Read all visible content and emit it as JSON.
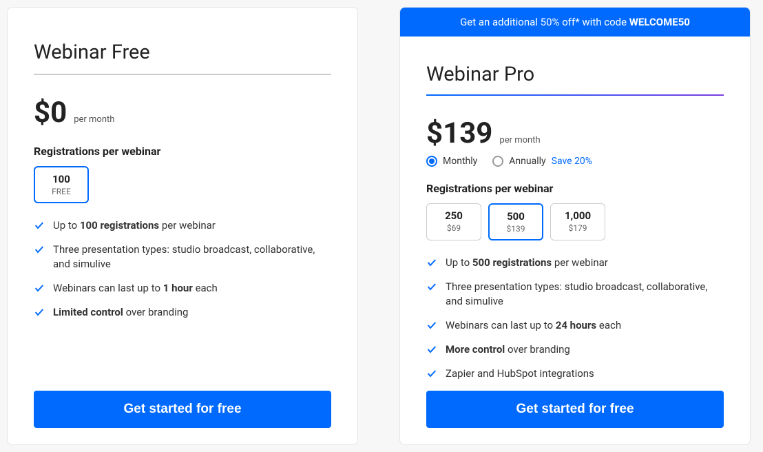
{
  "free": {
    "title": "Webinar Free",
    "price": "$0",
    "per": "per month",
    "reg_label": "Registrations per webinar",
    "tiers": [
      {
        "num": "100",
        "sub": "FREE",
        "selected": true
      }
    ],
    "features": [
      {
        "html": "Up to <b>100 registrations</b> per webinar"
      },
      {
        "html": "Three presentation types: studio broadcast, collaborative, and simulive"
      },
      {
        "html": "Webinars can last up to <b>1 hour</b> each"
      },
      {
        "html": "<b>Limited control</b> over branding"
      }
    ],
    "cta": "Get started for free"
  },
  "pro": {
    "banner_prefix": "Get an additional 50% off* with code ",
    "banner_code": "WELCOME50",
    "title": "Webinar Pro",
    "price": "$139",
    "per": "per month",
    "billing": {
      "monthly": "Monthly",
      "annually": "Annually",
      "save": "Save 20%"
    },
    "reg_label": "Registrations per webinar",
    "tiers": [
      {
        "num": "250",
        "sub": "$69",
        "selected": false
      },
      {
        "num": "500",
        "sub": "$139",
        "selected": true
      },
      {
        "num": "1,000",
        "sub": "$179",
        "selected": false
      }
    ],
    "features": [
      {
        "html": "Up to <b>500 registrations</b> per webinar"
      },
      {
        "html": "Three presentation types: studio broadcast, collaborative, and simulive"
      },
      {
        "html": "Webinars can last up to <b>24 hours</b> each"
      },
      {
        "html": "<b>More control</b> over branding"
      },
      {
        "html": "Zapier and HubSpot integrations"
      }
    ],
    "cta": "Get started for free"
  }
}
